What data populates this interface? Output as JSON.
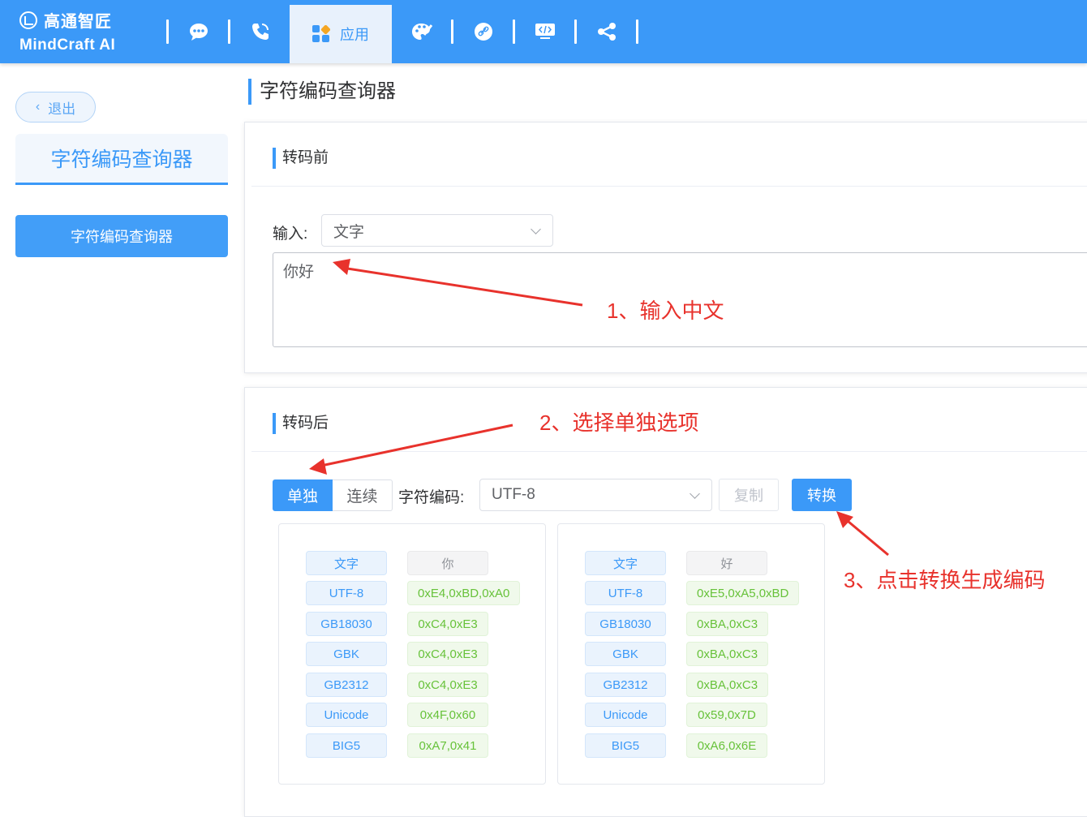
{
  "brand": {
    "name_cn": "高通智匠",
    "name_en": "MindCraft AI"
  },
  "nav": {
    "active_label": "应用"
  },
  "sidebar": {
    "back_label": "退出",
    "title": "字符编码查询器",
    "item_label": "字符编码查询器"
  },
  "page": {
    "title": "字符编码查询器"
  },
  "before": {
    "heading": "转码前",
    "input_label": "输入:",
    "input_type": "文字",
    "text_value": "你好"
  },
  "after": {
    "heading": "转码后",
    "mode_single": "单独",
    "mode_continuous": "连续",
    "encoding_label": "字符编码:",
    "encoding_value": "UTF-8",
    "copy_label": "复制",
    "convert_label": "转换"
  },
  "results": [
    {
      "char": "你",
      "rows": [
        {
          "key": "文字",
          "value": "你"
        },
        {
          "key": "UTF-8",
          "value": "0xE4,0xBD,0xA0"
        },
        {
          "key": "GB18030",
          "value": "0xC4,0xE3"
        },
        {
          "key": "GBK",
          "value": "0xC4,0xE3"
        },
        {
          "key": "GB2312",
          "value": "0xC4,0xE3"
        },
        {
          "key": "Unicode",
          "value": "0x4F,0x60"
        },
        {
          "key": "BIG5",
          "value": "0xA7,0x41"
        }
      ]
    },
    {
      "char": "好",
      "rows": [
        {
          "key": "文字",
          "value": "好"
        },
        {
          "key": "UTF-8",
          "value": "0xE5,0xA5,0xBD"
        },
        {
          "key": "GB18030",
          "value": "0xBA,0xC3"
        },
        {
          "key": "GBK",
          "value": "0xBA,0xC3"
        },
        {
          "key": "GB2312",
          "value": "0xBA,0xC3"
        },
        {
          "key": "Unicode",
          "value": "0x59,0x7D"
        },
        {
          "key": "BIG5",
          "value": "0xA6,0x6E"
        }
      ]
    }
  ],
  "annotations": {
    "step1": "1、输入中文",
    "step2": "2、选择单独选项",
    "step3": "3、点击转换生成编码"
  },
  "colors": {
    "primary": "#3b99f8",
    "annotation": "#e8322c",
    "success": "#67c23a"
  },
  "nav_icons": [
    "chat-icon",
    "phone-icon",
    "apps-icon",
    "palette-icon",
    "link-icon",
    "code-icon",
    "share-icon"
  ]
}
